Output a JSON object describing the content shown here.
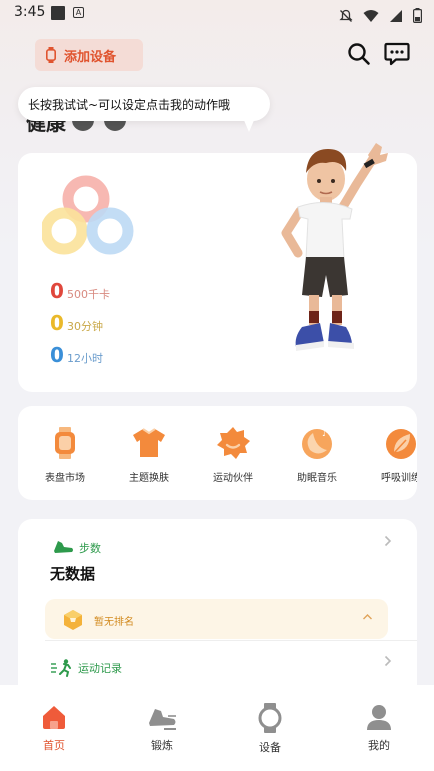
{
  "status_bar": {
    "time": "3:45",
    "badge_letter": "A"
  },
  "header": {
    "add_device_label": "添加设备",
    "title": "健康"
  },
  "tooltip": {
    "text": "长按我试试~可以设定点击我的动作哦"
  },
  "health": {
    "metrics": [
      {
        "value": "0",
        "label": "500千卡"
      },
      {
        "value": "0",
        "label": "30分钟"
      },
      {
        "value": "0",
        "label": "12小时"
      }
    ]
  },
  "shortcuts": [
    {
      "label": "表盘市场",
      "icon": "watch-face-icon"
    },
    {
      "label": "主题换肤",
      "icon": "shirt-icon"
    },
    {
      "label": "运动伙伴",
      "icon": "buddy-icon"
    },
    {
      "label": "助眠音乐",
      "icon": "moon-music-icon"
    },
    {
      "label": "呼吸训练",
      "icon": "leaf-icon"
    }
  ],
  "steps": {
    "label": "步数",
    "value": "无数据",
    "rank_label": "暂无排名",
    "records_label": "运动记录"
  },
  "tabs": [
    {
      "label": "首页",
      "icon": "home-icon",
      "active": true
    },
    {
      "label": "锻炼",
      "icon": "shoe-icon",
      "active": false
    },
    {
      "label": "设备",
      "icon": "watch-icon",
      "active": false
    },
    {
      "label": "我的",
      "icon": "profile-icon",
      "active": false
    }
  ],
  "colors": {
    "accent": "#e0542f",
    "calorie": "#e0473c",
    "duration": "#eab92a",
    "sleep": "#3a8fd8",
    "steps_green": "#2e9a4c",
    "rank_orange": "#d28a1e"
  }
}
